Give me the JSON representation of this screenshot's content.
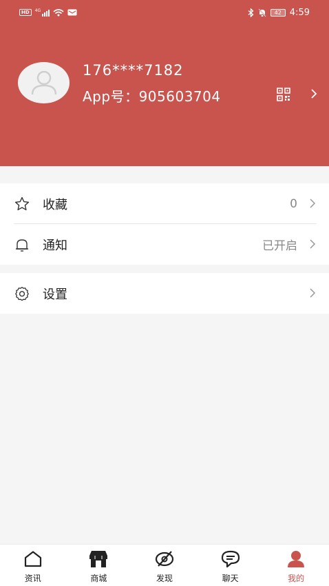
{
  "status_bar": {
    "left_chip": "HD",
    "network": "4G",
    "battery": "42",
    "time": "4:59"
  },
  "profile": {
    "phone": "176****7182",
    "app_id": "App号：905603704"
  },
  "menu": {
    "favorites": {
      "label": "收藏",
      "value": "0"
    },
    "notifications": {
      "label": "通知",
      "value": "已开启"
    },
    "settings": {
      "label": "设置"
    }
  },
  "tabbar": {
    "items": [
      {
        "label": "资讯",
        "icon": "home-icon"
      },
      {
        "label": "商城",
        "icon": "store-icon"
      },
      {
        "label": "发现",
        "icon": "discover-icon"
      },
      {
        "label": "聊天",
        "icon": "chat-icon"
      },
      {
        "label": "我的",
        "icon": "user-icon"
      }
    ],
    "active_index": 4
  },
  "colors": {
    "brand": "#c9544e",
    "background": "#f5f5f5"
  }
}
